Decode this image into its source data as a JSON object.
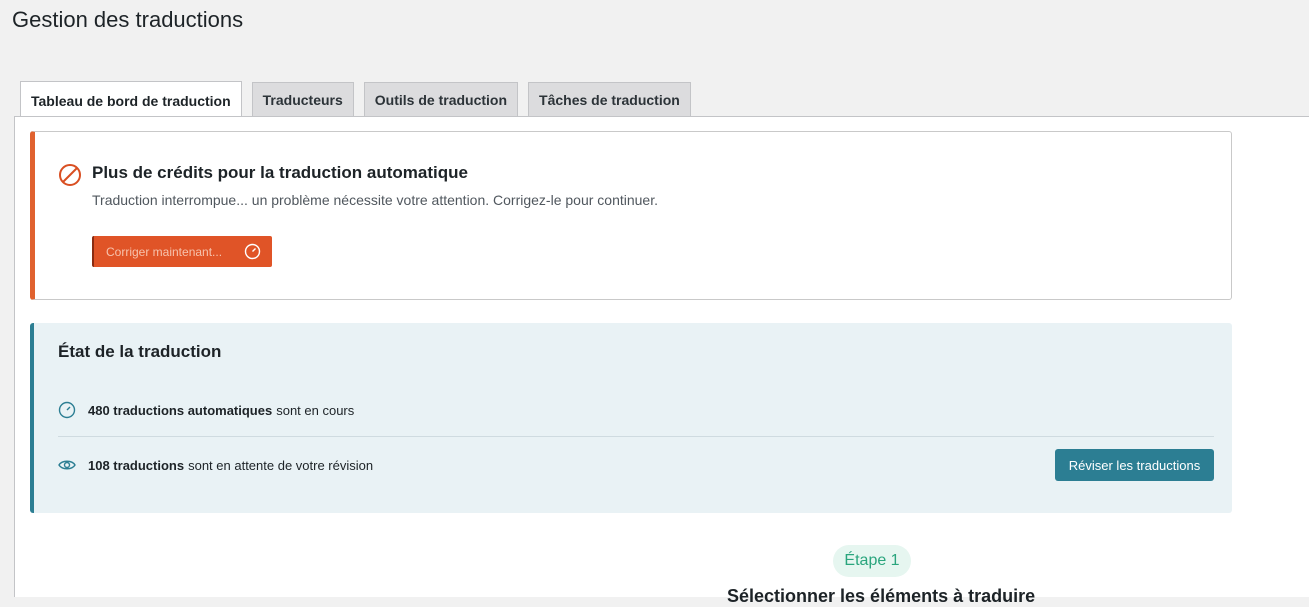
{
  "page": {
    "title": "Gestion des traductions"
  },
  "tabs": [
    {
      "label": "Tableau de bord de traduction",
      "active": true
    },
    {
      "label": "Traducteurs",
      "active": false
    },
    {
      "label": "Outils de traduction",
      "active": false
    },
    {
      "label": "Tâches de traduction",
      "active": false
    }
  ],
  "alert": {
    "icon": "prohibited-icon",
    "title": "Plus de crédits pour la traduction automatique",
    "message": "Traduction interrompue... un problème nécessite votre attention. Corrigez-le pour continuer.",
    "button_label": "Corriger maintenant...",
    "accent_color": "#e05427"
  },
  "status": {
    "title": "État de la traduction",
    "rows": [
      {
        "icon": "progress-icon",
        "count": "480 traductions automatiques",
        "text": "sont en cours"
      },
      {
        "icon": "eye-icon",
        "count": "108 traductions",
        "text": "sont en attente de votre révision"
      }
    ],
    "review_button": "Réviser les traductions",
    "accent_color": "#2c7e93"
  },
  "step": {
    "badge": "Étape 1",
    "heading": "Sélectionner les éléments à traduire"
  }
}
